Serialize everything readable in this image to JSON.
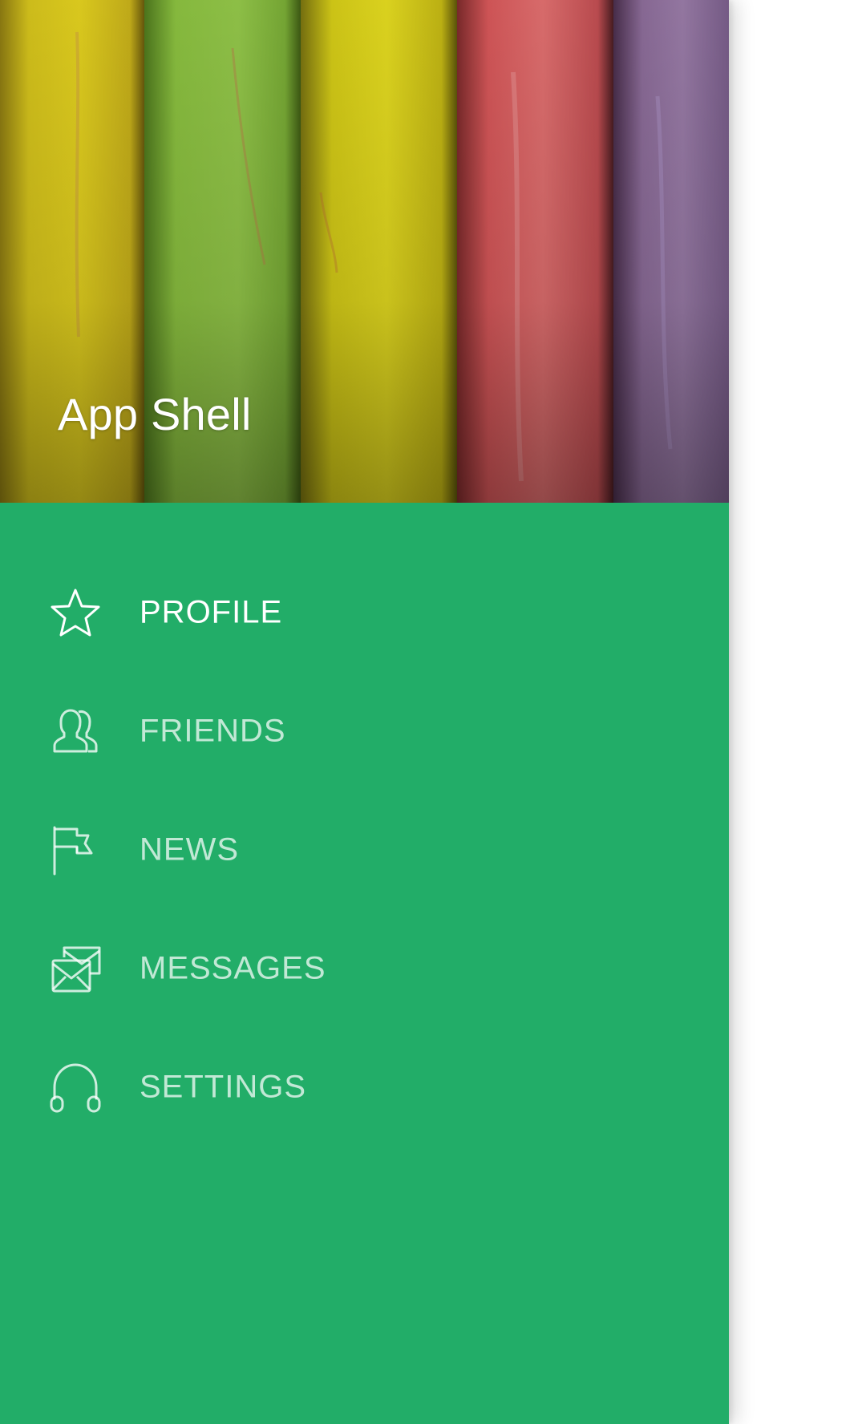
{
  "drawer": {
    "header": {
      "title": "App Shell",
      "image_icon": "chalk-sticks-photo"
    },
    "background_color": "#22ad68",
    "items": [
      {
        "label": "PROFILE",
        "icon": "star-icon",
        "active": true
      },
      {
        "label": "FRIENDS",
        "icon": "people-icon",
        "active": false
      },
      {
        "label": "NEWS",
        "icon": "flag-icon",
        "active": false
      },
      {
        "label": "MESSAGES",
        "icon": "envelopes-icon",
        "active": false
      },
      {
        "label": "SETTINGS",
        "icon": "headphones-icon",
        "active": false
      }
    ]
  }
}
